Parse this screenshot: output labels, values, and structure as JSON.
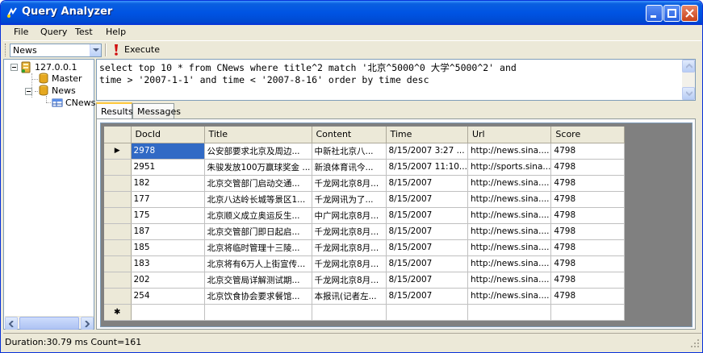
{
  "window": {
    "title": "Query Analyzer"
  },
  "menu": [
    {
      "label": "File"
    },
    {
      "label": "Query"
    },
    {
      "label": "Test"
    },
    {
      "label": "Help"
    }
  ],
  "toolbar": {
    "database_selected": "News",
    "execute_label": "Execute"
  },
  "tree": {
    "server": "127.0.0.1",
    "databases": [
      "Master",
      "News"
    ],
    "table": "CNews"
  },
  "query": {
    "line1": "select top 10 * from CNews where title^2 match '北京^5000^0 大学^5000^2' and",
    "line2": "time > '2007-1-1' and time < '2007-8-16' order by time desc"
  },
  "tabs": [
    {
      "label": "Results",
      "active": true
    },
    {
      "label": "Messages",
      "active": false
    }
  ],
  "grid": {
    "columns": [
      "DocId",
      "Title",
      "Content",
      "Time",
      "Url",
      "Score"
    ],
    "rows": [
      [
        "2978",
        "公安部要求北京及周边...",
        "中新社北京八...",
        "8/15/2007 3:27 ...",
        "http://news.sina....",
        "4798"
      ],
      [
        "2951",
        "朱骏发放100万赢球奖金 ...",
        "新浪体育讯今...",
        "8/15/2007 11:10...",
        "http://sports.sina...",
        "4798"
      ],
      [
        "182",
        "北京交管部门启动交通...",
        "千龙网北京8月...",
        "8/15/2007",
        "http://news.sina....",
        "4798"
      ],
      [
        "177",
        "北京八达岭长城等景区1...",
        "千龙网讯为了...",
        "8/15/2007",
        "http://news.sina....",
        "4798"
      ],
      [
        "175",
        "北京顺义成立奥运反生...",
        "中广网北京8月...",
        "8/15/2007",
        "http://news.sina....",
        "4798"
      ],
      [
        "187",
        "北京交管部门即日起启...",
        "千龙网北京8月...",
        "8/15/2007",
        "http://news.sina....",
        "4798"
      ],
      [
        "185",
        "北京将临时管理十三陵...",
        "千龙网北京8月...",
        "8/15/2007",
        "http://news.sina....",
        "4798"
      ],
      [
        "183",
        "北京将有6万人上街宣传...",
        "千龙网北京8月...",
        "8/15/2007",
        "http://news.sina....",
        "4798"
      ],
      [
        "202",
        "北京交管局详解测试期...",
        "千龙网北京8月...",
        "8/15/2007",
        "http://news.sina....",
        "4798"
      ],
      [
        "254",
        "北京饮食协会要求餐馆...",
        "本报讯(记者左...",
        "8/15/2007",
        "http://news.sina....",
        "4798"
      ]
    ],
    "current_row_marker": "▶",
    "new_row_marker": "✱"
  },
  "status": {
    "text": "Duration:30.79 ms Count=161"
  }
}
